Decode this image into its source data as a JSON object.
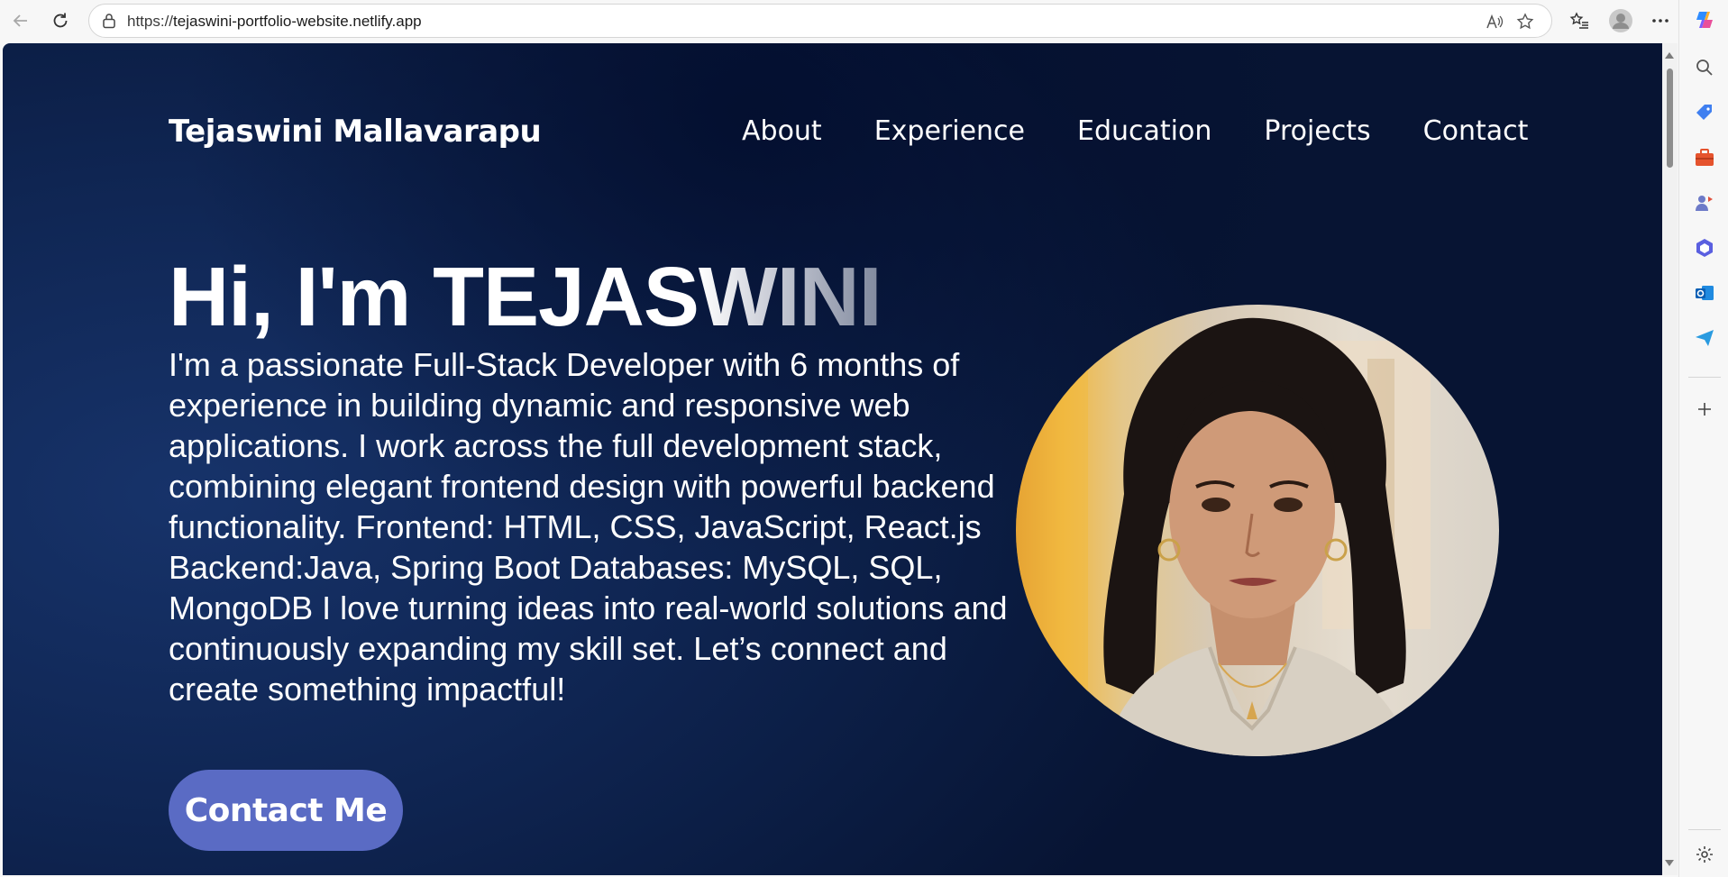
{
  "browser": {
    "url_scheme": "https://",
    "url_host": "tejaswini-portfolio-website.netlify.app"
  },
  "site": {
    "logo": "Tejaswini Mallavarapu",
    "nav": [
      "About",
      "Experience",
      "Education",
      "Projects",
      "Contact"
    ],
    "hero": {
      "greeting": "Hi, I'm TEJAS",
      "greeting_fade": "WINI",
      "bio": "I'm a passionate Full-Stack Developer with 6 months of experience in building dynamic and responsive web applications. I work across the full development stack, combining elegant frontend design with powerful backend functionality. Frontend: HTML, CSS, JavaScript, React.js Backend:Java, Spring Boot Databases: MySQL, SQL, MongoDB I love turning ideas into real-world solutions and continuously expanding my skill set. Let’s connect and create something impactful!",
      "cta": "Contact Me"
    }
  },
  "colors": {
    "page_bg": "#0f2552",
    "cta_bg": "#5a6bc4"
  }
}
